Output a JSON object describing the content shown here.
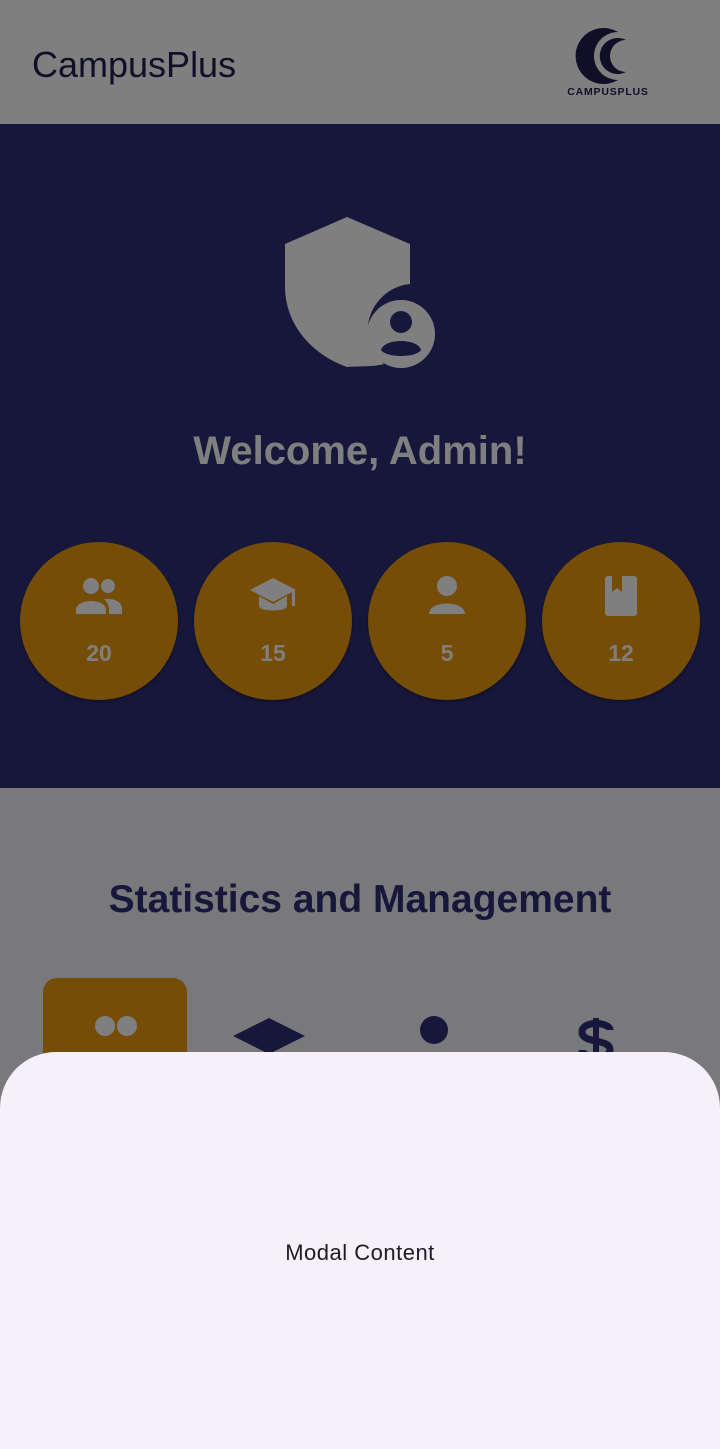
{
  "app_bar": {
    "title": "CampusPlus",
    "logo_text": "CAMPUSPLUS",
    "logo_icon": "crescent-logo-icon"
  },
  "hero": {
    "icon": "admin-shield-icon",
    "welcome_text": "Welcome, Admin!",
    "stats": [
      {
        "icon": "group-icon",
        "value": "20"
      },
      {
        "icon": "graduation-cap-icon",
        "value": "15"
      },
      {
        "icon": "person-icon",
        "value": "5"
      },
      {
        "icon": "book-icon",
        "value": "12"
      }
    ]
  },
  "stats_section": {
    "title": "Statistics and Management",
    "tabs": [
      {
        "icon": "group-icon",
        "active": true
      },
      {
        "icon": "graduation-cap-icon",
        "active": false
      },
      {
        "icon": "person-icon",
        "active": false
      },
      {
        "icon": "dollar-icon",
        "active": false
      }
    ]
  },
  "modal": {
    "content": "Modal Content"
  },
  "colors": {
    "brand_navy": "#2f2f77",
    "accent_orange": "#ea9a0c",
    "sheet_background": "#f5f0f9"
  }
}
